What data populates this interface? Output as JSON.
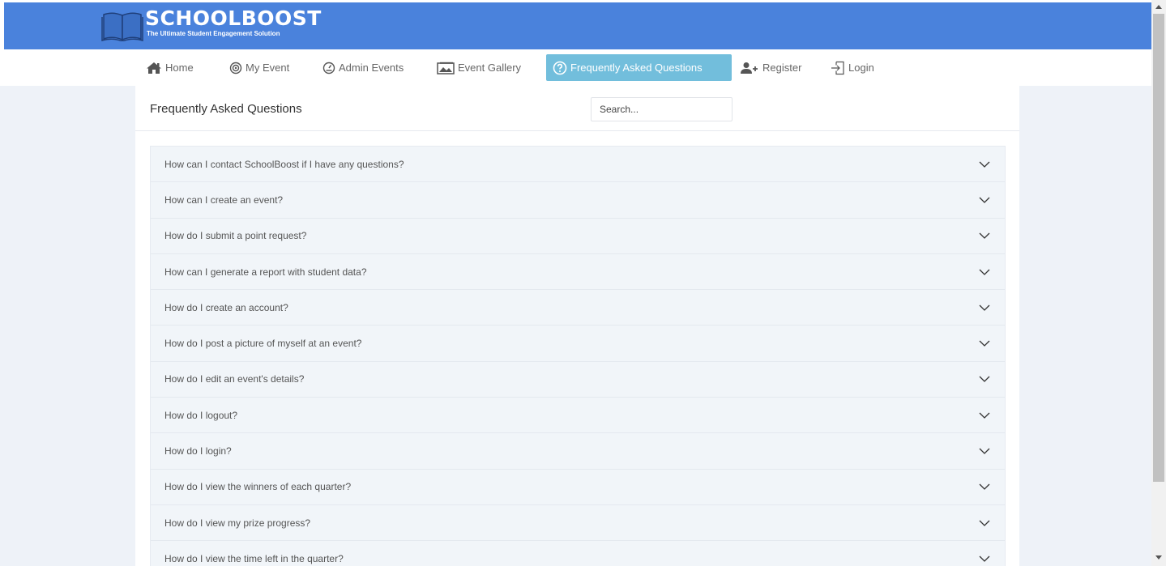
{
  "brand": {
    "name": "SCHOOLBOOST",
    "tagline": "The Ultimate Student Engagement Solution"
  },
  "nav": {
    "items": [
      {
        "label": "Home",
        "icon": "home-icon"
      },
      {
        "label": "My Event",
        "icon": "target-icon"
      },
      {
        "label": "Admin Events",
        "icon": "gauge-icon"
      },
      {
        "label": "Event Gallery",
        "icon": "gallery-icon"
      },
      {
        "label": "Frequently Asked Questions",
        "icon": "question-circle-icon",
        "active": true
      },
      {
        "label": "Register",
        "icon": "add-user-icon"
      },
      {
        "label": "Login",
        "icon": "login-icon"
      }
    ]
  },
  "page": {
    "title": "Frequently Asked Questions",
    "search_placeholder": "Search..."
  },
  "faq": [
    "How can I contact SchoolBoost if I have any questions?",
    "How can I create an event?",
    "How do I submit a point request?",
    "How can I generate a report with student data?",
    "How do I create an account?",
    "How do I post a picture of myself at an event?",
    "How do I edit an event's details?",
    "How do I logout?",
    "How do I login?",
    "How do I view the winners of each quarter?",
    "How do I view my prize progress?",
    "How do I view the time left in the quarter?"
  ],
  "colors": {
    "banner": "#4a82dc",
    "active_tab": "#72bedc",
    "page_background": "#eef2f8",
    "faq_item_background": "#f1f5f9"
  }
}
